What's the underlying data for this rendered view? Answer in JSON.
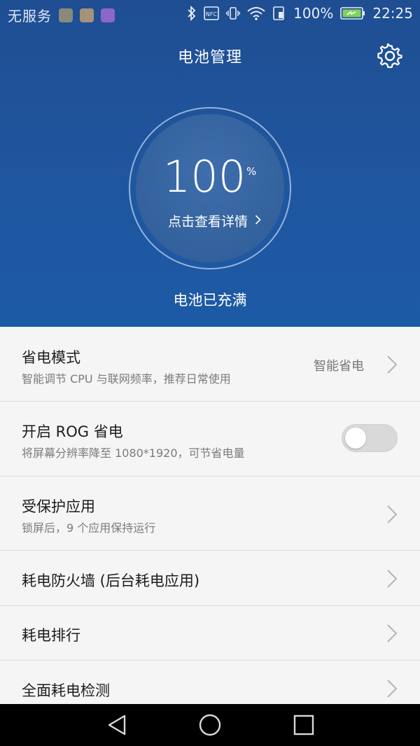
{
  "status_bar": {
    "carrier": "无服务",
    "notification_icons": [
      "news-app-icon",
      "gallery-app-icon",
      "keyboard-app-icon"
    ],
    "icons": [
      "bluetooth-icon",
      "nfc-icon",
      "vibrate-icon",
      "wifi-icon",
      "sim-battery-icon"
    ],
    "nfc_label": "NFC",
    "battery_percent": "100%",
    "time": "22:25"
  },
  "header": {
    "title": "电池管理",
    "settings_icon": "gear-icon"
  },
  "battery": {
    "level": "100",
    "unit": "%",
    "detail_link": "点击查看详情",
    "status": "电池已充满"
  },
  "settings": {
    "power_mode": {
      "title": "省电模式",
      "subtitle": "智能调节 CPU 与联网频率，推荐日常使用",
      "value": "智能省电"
    },
    "rog": {
      "title": "开启 ROG 省电",
      "subtitle": "将屏幕分辨率降至 1080*1920，可节省电量",
      "enabled": false
    },
    "protected_apps": {
      "title": "受保护应用",
      "subtitle": "锁屏后，9 个应用保持运行"
    },
    "power_firewall": {
      "title": "耗电防火墙 (后台耗电应用)"
    },
    "power_ranking": {
      "title": "耗电排行"
    },
    "full_check": {
      "title": "全面耗电检测"
    }
  },
  "colors": {
    "header_blue": "#1f569f",
    "list_background": "#f5f5f5",
    "navbar": "#000000"
  },
  "nav": [
    "back-icon",
    "home-icon",
    "recents-icon"
  ]
}
